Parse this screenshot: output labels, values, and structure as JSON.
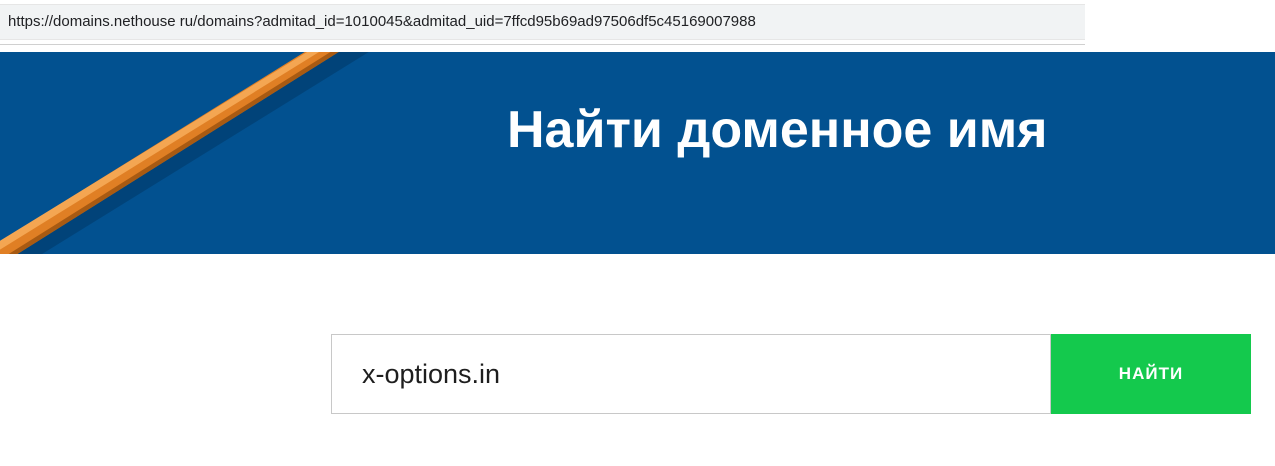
{
  "browser": {
    "url": "https://domains.nethouse ru/domains?admitad_id=1010045&admitad_uid=7ffcd95b69ad97506df5c45169007988"
  },
  "hero": {
    "title": "Найти доменное имя",
    "background_color": "#025190",
    "decoration_icon": "pencil-icon"
  },
  "search": {
    "input_value": "x-options.in",
    "button_label": "НАЙТИ",
    "button_color": "#14c94d"
  }
}
